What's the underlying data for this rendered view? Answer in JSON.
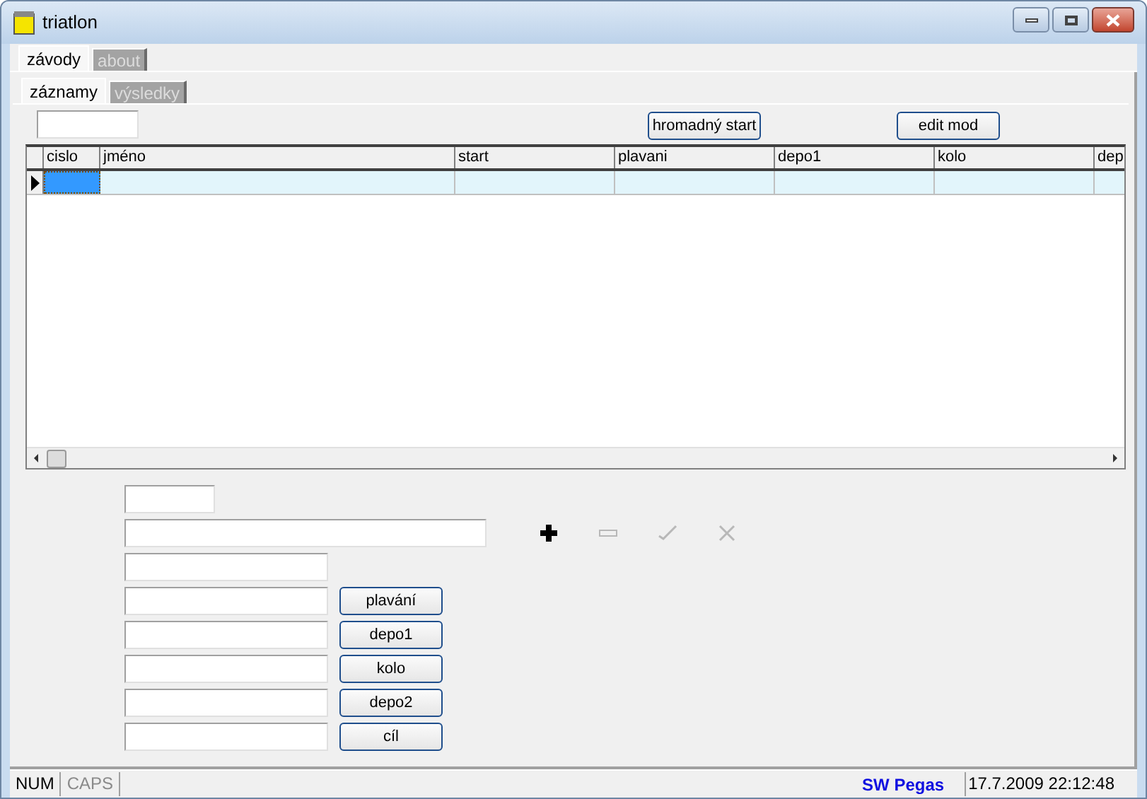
{
  "window": {
    "title": "triatlon"
  },
  "main_tabs": [
    {
      "label": "závody",
      "selected": true
    },
    {
      "label": "about",
      "selected": false
    }
  ],
  "sub_tabs": [
    {
      "label": "záznamy",
      "selected": true
    },
    {
      "label": "výsledky",
      "selected": false
    }
  ],
  "toolbar_buttons": [
    "hromadný start",
    "edit mod"
  ],
  "grid": {
    "columns": [
      "cislo",
      "jméno",
      "start",
      "plavani",
      "depo1",
      "kolo",
      "dep"
    ],
    "rows": [
      {
        "current": true
      }
    ]
  },
  "navigator": [
    {
      "kind": "add",
      "disabled": false
    },
    {
      "kind": "remove",
      "disabled": true
    },
    {
      "kind": "confirm",
      "disabled": true
    },
    {
      "kind": "cancel",
      "disabled": true
    }
  ],
  "split_buttons": [
    "plavání",
    "depo1",
    "kolo",
    "depo2",
    "cíl"
  ],
  "status_bar": {
    "keys": [
      {
        "text": "NUM",
        "on": true
      },
      {
        "text": "CAPS",
        "on": false
      }
    ],
    "brand": "SW Pegas",
    "datetime": "17.7.2009 22:12:48"
  }
}
